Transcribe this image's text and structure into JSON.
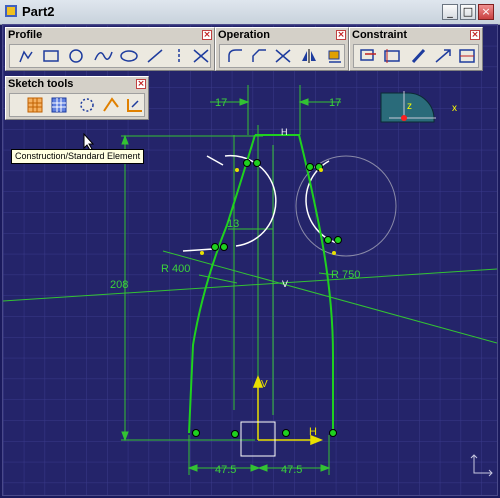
{
  "window": {
    "title": "Part2",
    "minimize_label": "_",
    "maximize_label": "□",
    "close_label": "×"
  },
  "toolbars": {
    "profile": {
      "title": "Profile",
      "close_label": "×"
    },
    "operation": {
      "title": "Operation",
      "close_label": "×"
    },
    "constraint": {
      "title": "Constraint",
      "close_label": "×"
    },
    "sketch_tools": {
      "title": "Sketch tools",
      "close_label": "×"
    }
  },
  "tooltip": "Construction/Standard Element",
  "compass": {
    "axis_z": "z",
    "axis_x": "x"
  },
  "sketch": {
    "dim_top_left": "17",
    "dim_top_right": "17",
    "dim_mid": "13",
    "radius_left": "R 400",
    "radius_right": "R 750",
    "height": "208",
    "base_left": "47.5",
    "base_right": "47.5",
    "label_h_top": "H",
    "label_v_mid": "V",
    "axis_v": "V",
    "axis_h": "H"
  },
  "colors": {
    "background": "#24246a",
    "grid": "#3a3a8a",
    "profile": "#1fd11f",
    "construction": "#33c233",
    "axis": "#e8e000",
    "arc": "#ffffff"
  }
}
